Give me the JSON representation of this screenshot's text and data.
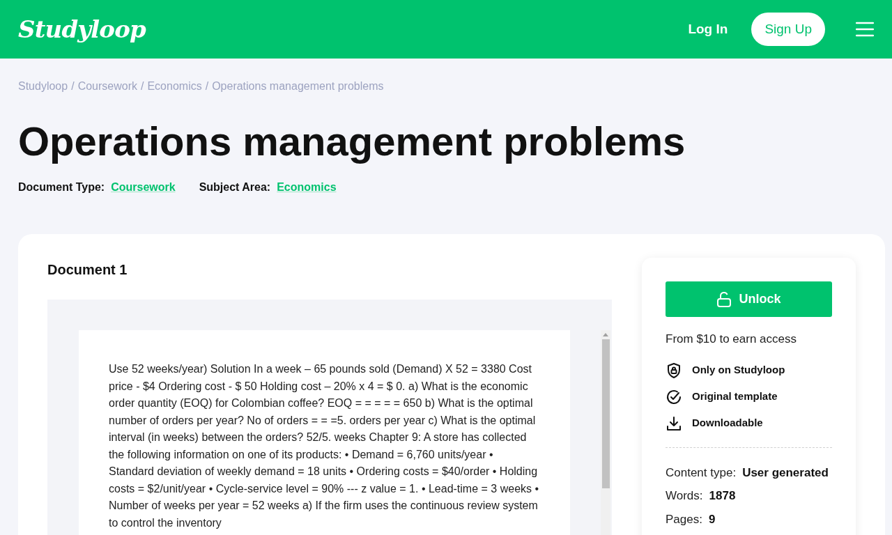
{
  "header": {
    "logo": "Studyloop",
    "log_in": "Log In",
    "sign_up": "Sign Up"
  },
  "breadcrumb": {
    "separator": "/",
    "items": [
      "Studyloop",
      "Coursework",
      "Economics",
      "Operations management problems"
    ]
  },
  "title": "Operations management problems",
  "meta": [
    {
      "label": "Document Type:",
      "value": "Coursework"
    },
    {
      "label": "Subject Area:",
      "value": "Economics"
    }
  ],
  "document": {
    "heading": "Document 1",
    "text": "Use 52 weeks/year) Solution In a week – 65 pounds sold (Demand) X 52 = 3380 Cost price - $4 Ordering cost - $ 50 Holding cost – 20% x 4 = $ 0. a) What is the economic order quantity (EOQ) for Colombian coffee? EOQ = = = = = 650 b) What is the optimal number of orders per year? No of orders = = =5. orders per year c) What is the optimal interval (in weeks) between the orders? 52/5. weeks Chapter 9: A store has collected the following information on one of its products: • Demand = 6,760 units/year • Standard deviation of weekly demand = 18 units • Ordering costs = $40/order • Holding costs = $2/unit/year • Cycle-service level = 90% --- z value = 1. • Lead-time = 3 weeks • Number of weeks per year = 52 weeks a) If the firm uses the continuous review system to control the inventory"
  },
  "sidebar": {
    "unlock": "Unlock",
    "price_note": "From $10 to earn access",
    "features": [
      {
        "kind": "shield",
        "label": "Only on Studyloop"
      },
      {
        "kind": "check",
        "label": "Original template"
      },
      {
        "kind": "download",
        "label": "Downloadable"
      }
    ],
    "details": [
      {
        "label": "Content type:",
        "value": "User generated"
      },
      {
        "label": "Words:",
        "value": "1878"
      },
      {
        "label": "Pages:",
        "value": "9"
      }
    ]
  }
}
